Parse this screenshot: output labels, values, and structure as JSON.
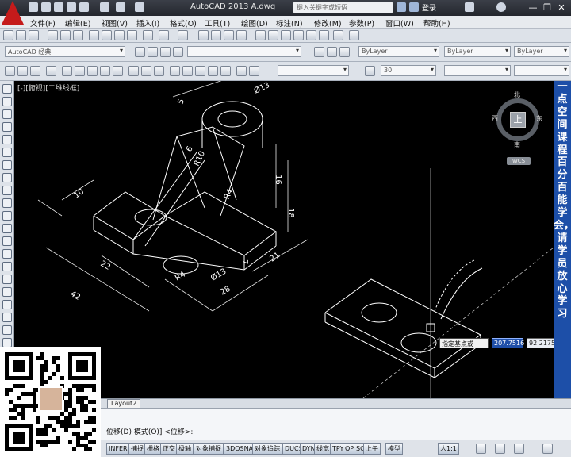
{
  "app": {
    "title": "AutoCAD 2013    A.dwg",
    "search_placeholder": "键入关键字或短语",
    "login_label": "登录",
    "window_controls": [
      "—",
      "❐",
      "✕"
    ]
  },
  "menu": [
    "文件(F)",
    "编辑(E)",
    "视图(V)",
    "插入(I)",
    "格式(O)",
    "工具(T)",
    "绘图(D)",
    "标注(N)",
    "修改(M)",
    "参数(P)",
    "窗口(W)",
    "帮助(H)"
  ],
  "toolbar": {
    "workspace_value": "AutoCAD 经典",
    "layer_value": "ByLayer",
    "linetype_value": "ByLayer",
    "lineweight_value": "ByLayer",
    "dim_style_value": "",
    "text_height_value": "30"
  },
  "viewport": {
    "label": "[-][俯视][二维线框]",
    "dimensions": [
      "Ø13",
      "5",
      "R10",
      "6",
      "16",
      "R4",
      "18",
      "10",
      "7",
      "22",
      "R4",
      "Ø13",
      "42",
      "28",
      "21"
    ],
    "prompt_label": "指定基点或",
    "coord_x": "207.7516",
    "coord_y": "92.2175"
  },
  "viewcube": {
    "north": "北",
    "south": "南",
    "east": "东",
    "west": "西",
    "face": "上",
    "wcs": "WCS"
  },
  "side_banner": "一点空间课程百分百能学会，请学员放心学习",
  "layout_tab": "Layout2",
  "command": {
    "line": "位移(D) 模式(O)] <位移>:"
  },
  "status_buttons": [
    "INFER",
    "捕捉",
    "栅格",
    "正交",
    "极轴",
    "对象捕捉",
    "3DOSNAP",
    "对象追踪",
    "DUCS",
    "DYN",
    "线宽",
    "TPY",
    "QP",
    "SC",
    "上午",
    "模型"
  ],
  "status_scale": "人1:1",
  "colors": {
    "canvas": "#000000",
    "drawing_lines": "#ffffff",
    "side_banner": "#1d4fa8",
    "title_bar": "#2b2e35"
  }
}
